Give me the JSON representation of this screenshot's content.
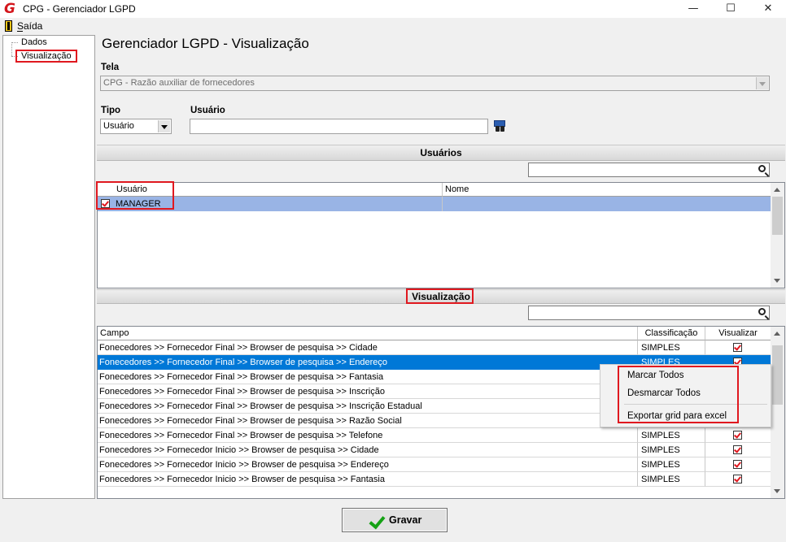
{
  "window": {
    "title": "CPG - Gerenciador LGPD",
    "logo": "G",
    "minimize": "—",
    "maximize": "☐",
    "close": "✕"
  },
  "menu": {
    "exit_label": "Saída"
  },
  "tree": {
    "items": [
      {
        "label": "Dados"
      },
      {
        "label": "Visualização"
      }
    ]
  },
  "page": {
    "title": "Gerenciador LGPD - Visualização"
  },
  "form": {
    "tela_label": "Tela",
    "tela_value": "CPG - Razão auxiliar de fornecedores",
    "tipo_label": "Tipo",
    "tipo_value": "Usuário",
    "usuario_label": "Usuário",
    "usuario_value": ""
  },
  "users_section": {
    "title": "Usuários",
    "search_value": "",
    "columns": [
      "Usuário",
      "Nome"
    ],
    "rows": [
      {
        "checked": true,
        "usuario": "MANAGER",
        "nome": ""
      }
    ]
  },
  "view_section": {
    "title": "Visualização",
    "search_value": "",
    "columns": [
      "Campo",
      "Classificação",
      "Visualizar"
    ],
    "rows": [
      {
        "campo": "Fonecedores >> Fornecedor  Final >> Browser de pesquisa >> Cidade",
        "classificacao": "SIMPLES",
        "visualizar": true
      },
      {
        "campo": "Fonecedores >> Fornecedor  Final >> Browser de pesquisa >> Endereço",
        "classificacao": "SIMPLES",
        "visualizar": true
      },
      {
        "campo": "Fonecedores >> Fornecedor  Final >> Browser de pesquisa >> Fantasia",
        "classificacao": "",
        "visualizar": true
      },
      {
        "campo": "Fonecedores >> Fornecedor  Final >> Browser de pesquisa >> Inscrição",
        "classificacao": "",
        "visualizar": true
      },
      {
        "campo": "Fonecedores >> Fornecedor  Final >> Browser de pesquisa >> Inscrição Estadual",
        "classificacao": "",
        "visualizar": true
      },
      {
        "campo": "Fonecedores >> Fornecedor  Final >> Browser de pesquisa >> Razão Social",
        "classificacao": "",
        "visualizar": true
      },
      {
        "campo": "Fonecedores >> Fornecedor  Final >> Browser de pesquisa >> Telefone",
        "classificacao": "SIMPLES",
        "visualizar": true
      },
      {
        "campo": "Fonecedores >> Fornecedor  Inicio >> Browser de pesquisa >> Cidade",
        "classificacao": "SIMPLES",
        "visualizar": true
      },
      {
        "campo": "Fonecedores >> Fornecedor  Inicio >> Browser de pesquisa >> Endereço",
        "classificacao": "SIMPLES",
        "visualizar": true
      },
      {
        "campo": "Fonecedores >> Fornecedor  Inicio >> Browser de pesquisa >> Fantasia",
        "classificacao": "SIMPLES",
        "visualizar": true
      }
    ],
    "selected_row": 1
  },
  "context_menu": {
    "items": [
      {
        "label": "Marcar Todos"
      },
      {
        "label": "Desmarcar Todos"
      },
      {
        "label": "Exportar grid para excel"
      }
    ]
  },
  "footer": {
    "save_label": "Gravar"
  },
  "colors": {
    "selection": "#0078d7",
    "highlight_user_row": "#99b4e5",
    "annotation": "#e0181f"
  }
}
